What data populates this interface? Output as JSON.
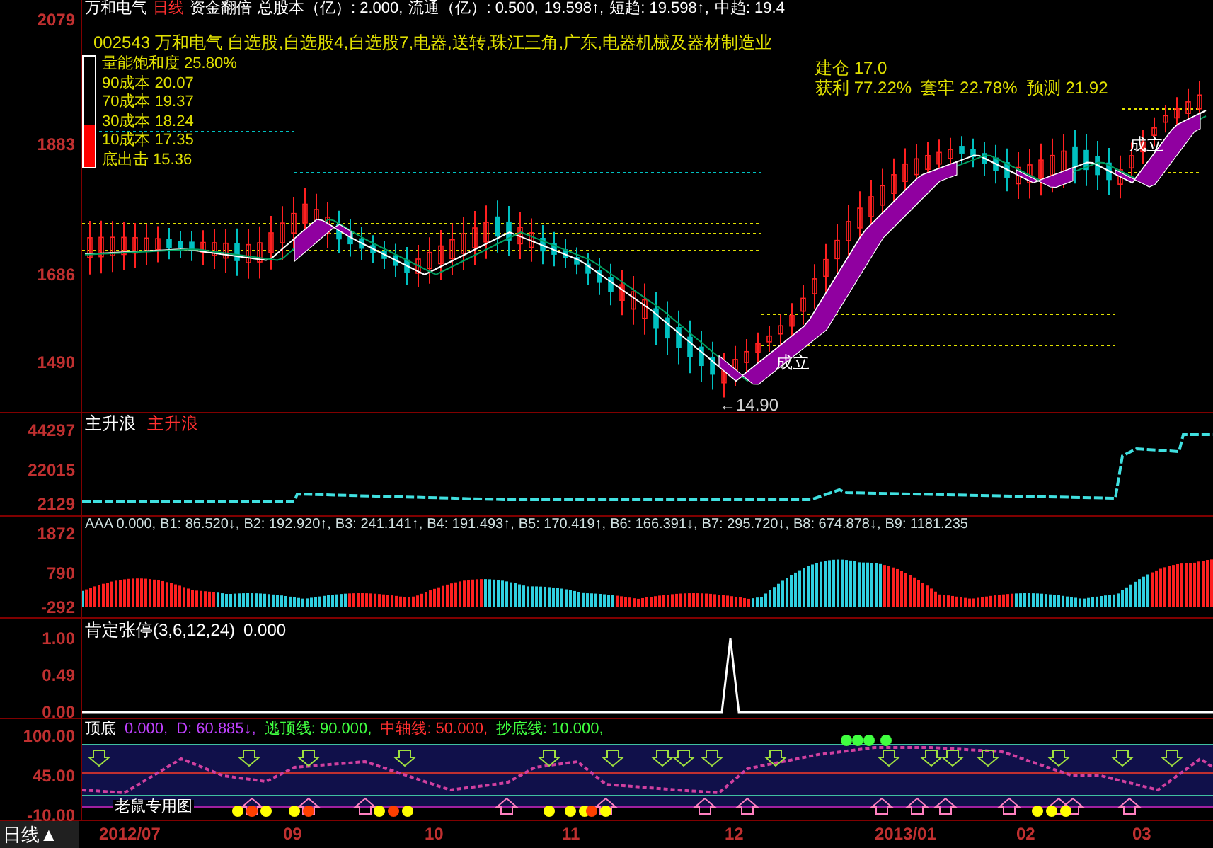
{
  "header": [
    {
      "text": "万和电气",
      "color": "#ffffff"
    },
    {
      "text": "日线",
      "color": "#ff3030"
    },
    {
      "text": "资金翻倍",
      "color": "#ffffff"
    },
    {
      "text": "总股本（亿）: 2.000,",
      "color": "#ffffff"
    },
    {
      "text": "流通（亿）: 0.500,",
      "color": "#ffffff"
    },
    {
      "text": "19.598↑,",
      "color": "#ffffff"
    },
    {
      "text": "短趋: 19.598↑,",
      "color": "#ffffff"
    },
    {
      "text": "中趋: 19.4",
      "color": "#ffffff"
    }
  ],
  "stock_info": "002543 万和电气 自选股,自选股4,自选股7,电器,送转,珠江三角,广东,电器机械及器材制造业",
  "cost_panel": {
    "level": 0.38,
    "lines": [
      "量能饱和度 25.80%",
      "90成本 20.07",
      "70成本 19.37",
      "30成本 18.24",
      "10成本 17.35",
      "底出击 15.36"
    ]
  },
  "position_info": [
    "建仓 17.0",
    "获利 77.22%  套牢 22.78%  预测 21.92"
  ],
  "main_chart": {
    "axis": [
      "2079",
      "1883",
      "1686",
      "1490"
    ],
    "annotations": [
      "成立",
      "成立",
      "←14.90"
    ]
  },
  "wave_panel": {
    "title": "主升浪",
    "subtitle": "主升浪",
    "axis": [
      "44297",
      "22015",
      "2129"
    ]
  },
  "aaa_panel": {
    "axis": [
      "1872",
      "790",
      "-292"
    ],
    "values": [
      "AAA 0.000,",
      "B1: 86.520↓,",
      "B2: 192.920↑,",
      "B3: 241.141↑,",
      "B4: 191.493↑,",
      "B5: 170.419↑,",
      "B6: 166.391↓,",
      "B7: 295.720↓,",
      "B8: 674.878↓,",
      "B9: 1181.235"
    ]
  },
  "limit_panel": {
    "title": "肯定张停(3,6,12,24)",
    "value": "0.000",
    "axis": [
      "1.00",
      "0.49",
      "0.00"
    ]
  },
  "top_bottom_panel": {
    "axis": [
      "100.00",
      "45.00",
      "-10.00"
    ],
    "tag": "老鼠专用图",
    "values": [
      {
        "text": "顶底",
        "color": "#ffffff"
      },
      {
        "text": "0.000,",
        "color": "#c040ff"
      },
      {
        "text": "D: 60.885↓,",
        "color": "#c040ff"
      },
      {
        "text": "逃顶线: 90.000,",
        "color": "#40ff40"
      },
      {
        "text": "中轴线: 50.000,",
        "color": "#ff3030"
      },
      {
        "text": "抄底线: 10.000,",
        "color": "#40ff40"
      }
    ]
  },
  "period_button": "日线▲",
  "dates": [
    "2012/07",
    "09",
    "10",
    "11",
    "12",
    "2013/01",
    "02",
    "03"
  ]
}
